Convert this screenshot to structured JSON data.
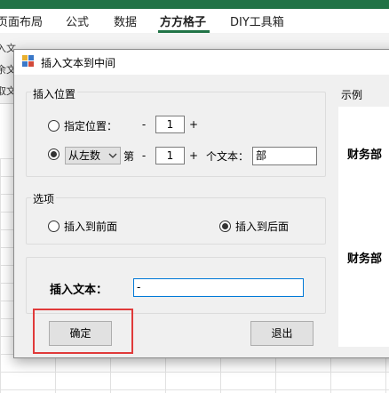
{
  "excel": {
    "tabs": [
      {
        "label": "页面布局"
      },
      {
        "label": "公式"
      },
      {
        "label": "数据"
      },
      {
        "label": "方方格子"
      },
      {
        "label": "DIY工具箱"
      }
    ],
    "ribbon_fragments": [
      "入文",
      "余文",
      "取文"
    ]
  },
  "dialog": {
    "title": "插入文本到中间",
    "position_group": {
      "title": "插入位置",
      "specify_label": "指定位置：",
      "specify_minus": "-",
      "specify_value": "1",
      "specify_plus": "+",
      "from_select": "从左数",
      "di_label": "第",
      "nth_minus": "-",
      "nth_value": "1",
      "nth_plus": "+",
      "text_label": "个文本：",
      "text_value": "部"
    },
    "options_group": {
      "title": "选项",
      "insert_front": "插入到前面",
      "insert_back": "插入到后面"
    },
    "insert_text_label": "插入文本：",
    "insert_text_value": "-",
    "ok_label": "确定",
    "exit_label": "退出",
    "example": {
      "title": "示例",
      "before": "财务部",
      "after": "财务部"
    }
  },
  "colors": {
    "excel_green": "#217346",
    "highlight_red": "#e03a3a",
    "focus_blue": "#0078d7"
  }
}
